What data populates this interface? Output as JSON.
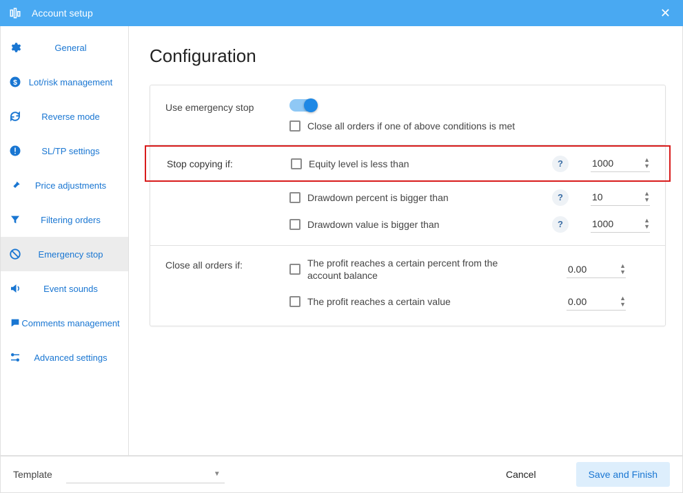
{
  "window": {
    "title": "Account setup",
    "close_glyph": "✕"
  },
  "sidebar": {
    "items": [
      {
        "id": "general",
        "label": "General",
        "icon": "gear"
      },
      {
        "id": "lot-risk",
        "label": "Lot/risk management",
        "icon": "dollar"
      },
      {
        "id": "reverse",
        "label": "Reverse mode",
        "icon": "refresh"
      },
      {
        "id": "sltp",
        "label": "SL/TP settings",
        "icon": "alert"
      },
      {
        "id": "price",
        "label": "Price adjustments",
        "icon": "pin"
      },
      {
        "id": "filtering",
        "label": "Filtering orders",
        "icon": "funnel"
      },
      {
        "id": "emergency",
        "label": "Emergency stop",
        "icon": "ban",
        "active": true
      },
      {
        "id": "sounds",
        "label": "Event sounds",
        "icon": "volume"
      },
      {
        "id": "comments",
        "label": "Comments management",
        "icon": "chat"
      },
      {
        "id": "advanced",
        "label": "Advanced settings",
        "icon": "sliders"
      }
    ]
  },
  "main": {
    "heading": "Configuration",
    "use_emergency_label": "Use emergency stop",
    "close_all_conditions_label": "Close all orders if one of above conditions is met",
    "stop_copying_label": "Stop copying if:",
    "close_all_label": "Close all orders if:",
    "options": {
      "equity": {
        "label": "Equity level is less than",
        "value": "1000",
        "help": "?"
      },
      "dd_percent": {
        "label": "Drawdown percent is bigger than",
        "value": "10",
        "help": "?"
      },
      "dd_value": {
        "label": "Drawdown value is bigger than",
        "value": "1000",
        "help": "?"
      },
      "profit_percent": {
        "label": "The profit reaches a certain percent from the account balance",
        "value": "0.00"
      },
      "profit_value": {
        "label": "The profit reaches a certain value",
        "value": "0.00"
      }
    }
  },
  "footer": {
    "template_label": "Template",
    "cancel_label": "Cancel",
    "save_label": "Save and Finish"
  }
}
